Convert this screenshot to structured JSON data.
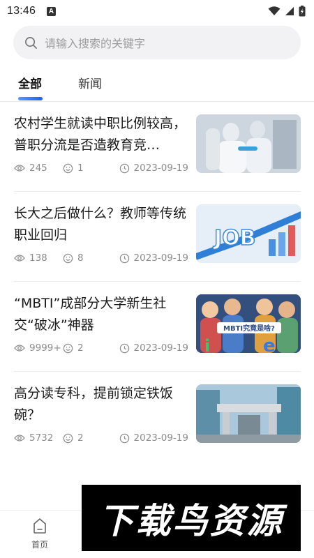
{
  "status_bar": {
    "time": "13:46",
    "notification_letter": "A"
  },
  "search": {
    "placeholder": "请输入搜索的关键字"
  },
  "tabs": [
    {
      "label": "全部",
      "active": true
    },
    {
      "label": "新闻",
      "active": false
    }
  ],
  "news": [
    {
      "title": "农村学生就读中职比例较高，普职分流是否造教育竞…",
      "views": "245",
      "comments": "1",
      "date": "2023-09-19",
      "thumb": "lab-scientists-photo"
    },
    {
      "title": "长大之后做什么？教师等传统职业回归",
      "views": "138",
      "comments": "8",
      "date": "2023-09-19",
      "thumb": "job-infographic",
      "thumb_text": "JOB"
    },
    {
      "title": "“MBTI”成部分大学新生社交“破冰”神器",
      "views": "9999+",
      "comments": "2",
      "date": "2023-09-19",
      "thumb": "mbti-illustration",
      "thumb_text": "MBTI究竟是啥?"
    },
    {
      "title": "高分读专科，提前锁定铁饭碗？",
      "views": "5732",
      "comments": "2",
      "date": "2023-09-19",
      "thumb": "campus-gate-photo"
    }
  ],
  "bottom_nav": {
    "home_label": "首页"
  },
  "watermark": {
    "text": "下载鸟资源"
  },
  "colors": {
    "accent": "#1e62e8",
    "meta_gray": "#8c8c8c",
    "search_bg": "#f2f2f4"
  }
}
